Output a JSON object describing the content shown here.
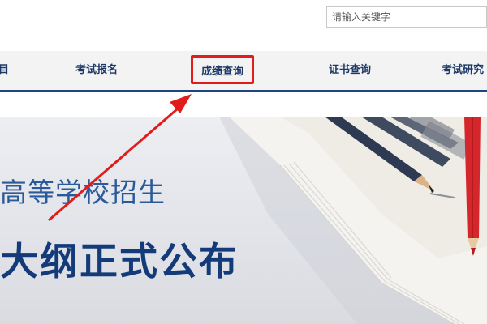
{
  "search": {
    "placeholder": "请输入关键字"
  },
  "nav": {
    "items": [
      {
        "label": "目"
      },
      {
        "label": "考试报名"
      },
      {
        "label": "成绩查询",
        "active": true
      },
      {
        "label": "证书查询"
      },
      {
        "label": "考试研究"
      }
    ]
  },
  "banner": {
    "subtitle": "高等学校招生",
    "title": "大纲正式公布"
  },
  "annotation": {
    "color": "#e21b1b",
    "highlight_target": "成绩查询"
  },
  "colors": {
    "nav_text": "#1d3866",
    "nav_border": "#1d4680",
    "banner_title": "#133b7a",
    "banner_subtitle": "#2b5a9a",
    "highlight": "#e21b1b"
  }
}
